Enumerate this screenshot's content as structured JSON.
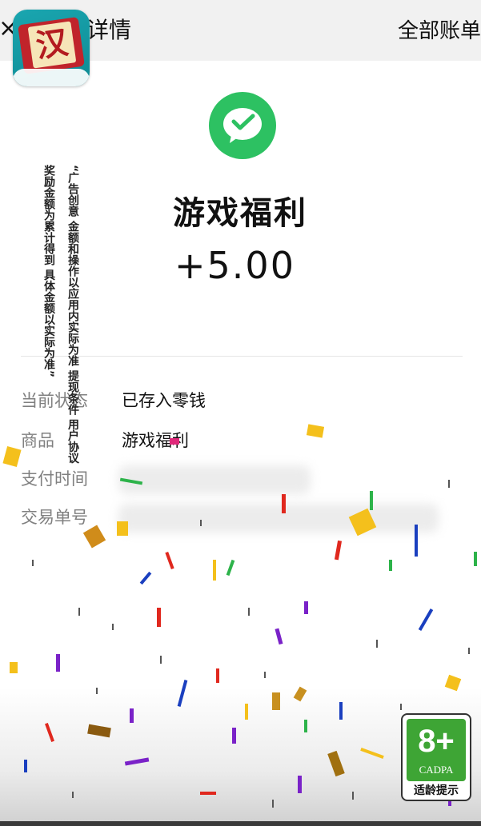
{
  "top_bar": {
    "close_glyph": "×",
    "title_partial": "详情",
    "all_bills_label": "全部账单"
  },
  "app_logo": {
    "character": "汉",
    "icon": "app-logo-icon"
  },
  "payment": {
    "icon": "wechat-pay-icon",
    "icon_color": "#2dc162",
    "product_name": "游戏福利",
    "amount": "+5.00"
  },
  "details": [
    {
      "label": "当前状态",
      "value": "已存入零钱"
    },
    {
      "label": "商品",
      "value": "游戏福利"
    },
    {
      "label": "支付时间",
      "value": ""
    },
    {
      "label": "交易单号",
      "value": ""
    }
  ],
  "ad_notice": {
    "col1": "“广告创意 金额和操作以应用内实际为准 提现条件 用户协议",
    "col2": "奖励金额为累计得到 具体金额以实际为准”"
  },
  "age_rating": {
    "number": "8+",
    "org": "CADPA",
    "caption": "适龄提示",
    "color": "#3ea535"
  }
}
